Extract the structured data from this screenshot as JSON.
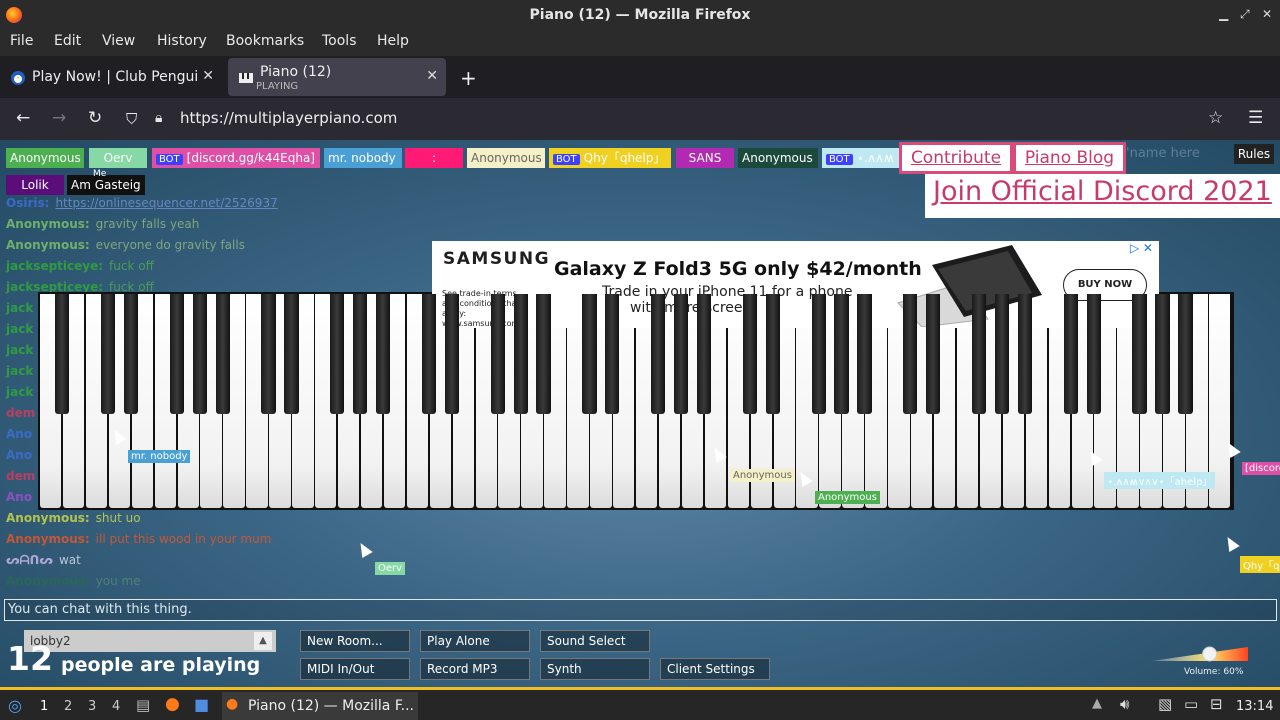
{
  "window": {
    "title": "Piano (12) — Mozilla Firefox"
  },
  "menu": [
    "File",
    "Edit",
    "View",
    "History",
    "Bookmarks",
    "Tools",
    "Help"
  ],
  "tabs": [
    {
      "label": "Play Now! | Club Penguin",
      "sub": ""
    },
    {
      "label": "Piano (12)",
      "sub": "PLAYING"
    }
  ],
  "url": "https://multiplayerpiano.com",
  "namebar": {
    "tags": [
      {
        "text": "Anonymous",
        "bot": false,
        "bg": "#4caf50",
        "fg": "#ffffff"
      },
      {
        "text": "Oerv",
        "bot": false,
        "bg": "#86d9a4",
        "fg": "#ffffff"
      },
      {
        "text": "[discord.gg/k44Eqha]",
        "bot": true,
        "bg": "#e04fa6",
        "fg": "#ffffff"
      },
      {
        "text": "mr. nobody",
        "bot": false,
        "bg": "#4aa0d5",
        "fg": "#ffffff"
      },
      {
        "text": ":",
        "bot": false,
        "bg": "#ff1a75",
        "fg": "#ffffff"
      },
      {
        "text": "Anonymous",
        "bot": false,
        "bg": "#f4f1c8",
        "fg": "#666666"
      },
      {
        "text": "Qhy「qhelp」",
        "bot": true,
        "bg": "#f0d020",
        "fg": "#ffffff"
      },
      {
        "text": "SANS",
        "bot": false,
        "bg": "#b12ab1",
        "fg": "#ffffff"
      },
      {
        "text": "Anonymous",
        "bot": false,
        "bg": "#1b4a3c",
        "fg": "#ffffff"
      },
      {
        "text": "⋆.ʌ∧ʍ",
        "bot": true,
        "bg": "#bfe9f2",
        "fg": "#ffffff"
      },
      {
        "text": "Lolik",
        "bot": false,
        "bg": "#5b0e7a",
        "fg": "#ffffff"
      },
      {
        "text": "Am Gasteig",
        "bot": false,
        "bg": "#111111",
        "fg": "#ffffff"
      }
    ],
    "me_label": "Me",
    "bot_label": "BOT",
    "contribute": "Contribute",
    "piano_blog": "Piano Blog",
    "name_placeholder": "'name here",
    "rules": "Rules",
    "promo": "Join Official Discord 2021"
  },
  "chat": [
    {
      "name": "Osiris:",
      "msg": "https://onlinesequencer.net/2526937",
      "color": "#3c6fd8",
      "msgcolor": "#6f8fd0"
    },
    {
      "name": "Anonymous:",
      "msg": "gravity falls yeah",
      "color": "#7cbf6b",
      "msgcolor": "#8fb37f"
    },
    {
      "name": "Anonymous:",
      "msg": "everyone do gravity falls",
      "color": "#7cbf6b",
      "msgcolor": "#8fb37f"
    },
    {
      "name": "jacksepticeye:",
      "msg": "fuck off",
      "color": "#2fa83a",
      "msgcolor": "#4fa84f"
    },
    {
      "name": "jacksepticeye:",
      "msg": "fuck off",
      "color": "#2fa83a",
      "msgcolor": "#4fa84f"
    },
    {
      "name": "jack",
      "msg": "",
      "color": "#2fa83a",
      "msgcolor": "#4fa84f"
    },
    {
      "name": "jack",
      "msg": "",
      "color": "#2fa83a",
      "msgcolor": "#4fa84f"
    },
    {
      "name": "jack",
      "msg": "",
      "color": "#2fa83a",
      "msgcolor": "#4fa84f"
    },
    {
      "name": "jack",
      "msg": "",
      "color": "#2fa83a",
      "msgcolor": "#4fa84f"
    },
    {
      "name": "jack",
      "msg": "",
      "color": "#2fa83a",
      "msgcolor": "#4fa84f"
    },
    {
      "name": "dem",
      "msg": "",
      "color": "#d23a5f",
      "msgcolor": "#d23a5f"
    },
    {
      "name": "Ano",
      "msg": "",
      "color": "#3c6fd8",
      "msgcolor": "#6f8fd0"
    },
    {
      "name": "Ano",
      "msg": "",
      "color": "#3c6fd8",
      "msgcolor": "#6f8fd0"
    },
    {
      "name": "dem",
      "msg": "",
      "color": "#d23a5f",
      "msgcolor": "#d23a5f"
    },
    {
      "name": "Ano",
      "msg": "",
      "color": "#9b4fd0",
      "msgcolor": "#9b4fd0"
    },
    {
      "name": "Anonymous:",
      "msg": "shut uo",
      "color": "#c9d64a",
      "msgcolor": "#c9d64a"
    },
    {
      "name": "Anonymous:",
      "msg": "ill put this wood in your mum",
      "color": "#e0562a",
      "msgcolor": "#e0562a"
    },
    {
      "name": "ᔕᗩᑎᔕ",
      "msg": "wat",
      "color": "#c5b7e8",
      "msgcolor": "#d6dbe6"
    },
    {
      "name": "Anonymous:",
      "msg": "you me",
      "color": "#2a6a4f",
      "msgcolor": "#4e8a73"
    }
  ],
  "ad": {
    "brand": "SAMSUNG",
    "smallprint": "See trade-in terms and conditions that apply: www.samsung.com.",
    "headline": "Galaxy Z Fold3 5G only $42/month",
    "line1": "Trade in your iPhone 11 for a phone",
    "line2": "with more screen",
    "cta": "BUY NOW"
  },
  "cursors": [
    {
      "label": "mr. nobody",
      "bg": "#4aa0d5",
      "fg": "#ffffff"
    },
    {
      "label": "Anonymous",
      "bg": "#f4f1c8",
      "fg": "#666666"
    },
    {
      "label": "Anonymous",
      "bg": "#4caf50",
      "fg": "#ffffff"
    },
    {
      "label": "⋆.ʌ∧ʍ∨ʌ∨⋆「ahelp」",
      "bg": "#bfe9f2",
      "fg": "#ffffff"
    },
    {
      "label": "[discord",
      "bg": "#e04fa6",
      "fg": "#ffffff"
    },
    {
      "label": "Oerv",
      "bg": "#86d9a4",
      "fg": "#ffffff"
    },
    {
      "label": "Qhy「q",
      "bg": "#f0d020",
      "fg": "#ffffff"
    }
  ],
  "chat_input_placeholder": "You can chat with this thing.",
  "room": "lobby2",
  "people_count": "12",
  "people_text": "people are playing",
  "buttons": {
    "new_room": "New Room...",
    "play_alone": "Play Alone",
    "sound_select": "Sound Select",
    "midi": "MIDI In/Out",
    "record": "Record MP3",
    "synth": "Synth",
    "client_settings": "Client Settings"
  },
  "volume": {
    "label": "Volume: 60%",
    "value": 0.6
  },
  "taskbar": {
    "workspaces": [
      "1",
      "2",
      "3",
      "4"
    ],
    "active_app": "Piano (12) — Mozilla F...",
    "clock": "13:14"
  }
}
